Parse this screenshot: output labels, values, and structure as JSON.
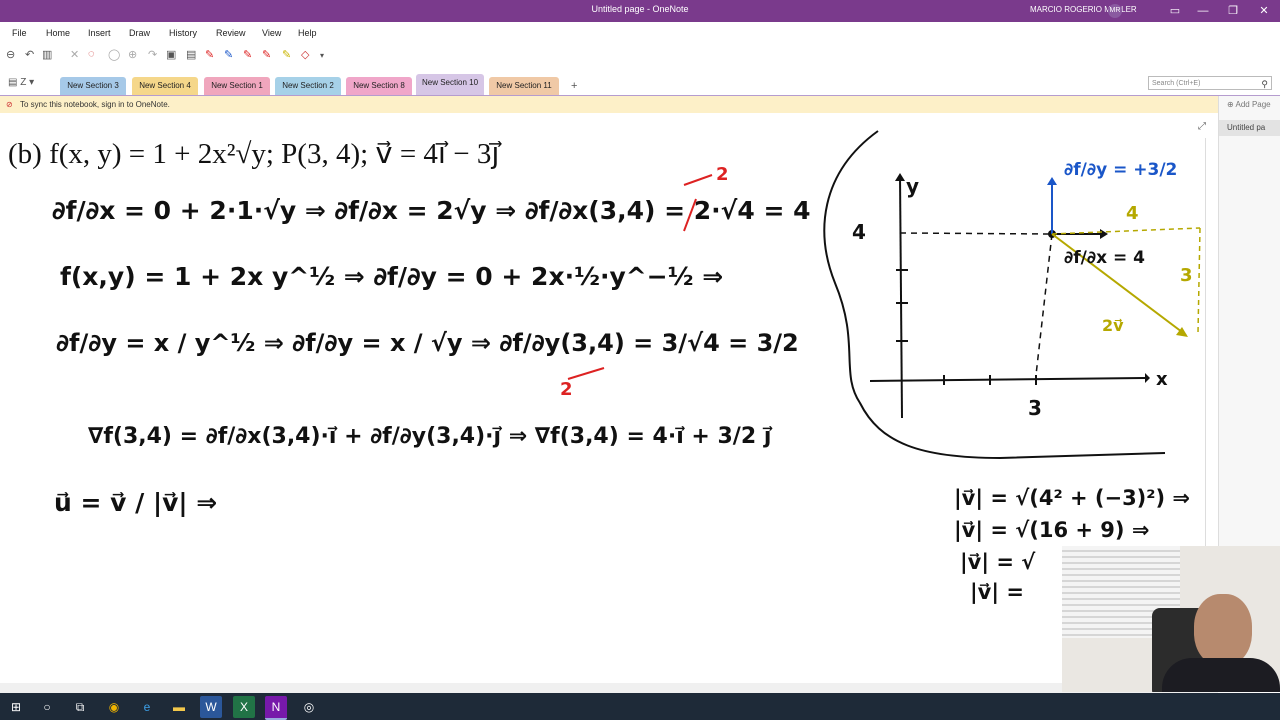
{
  "window": {
    "title": "Untitled page - OneNote",
    "user": "MARCIO ROGERIO MULLER",
    "user_initials": "MR",
    "controls": [
      "—",
      "❐",
      "✕"
    ]
  },
  "menu": [
    "File",
    "Home",
    "Insert",
    "Draw",
    "History",
    "Review",
    "View",
    "Help"
  ],
  "toolbar_icons": [
    "back-icon",
    "undo-icon",
    "layout-icon",
    "close-icon",
    "lasso-icon",
    "eraser-icon",
    "insert-space-icon",
    "print-icon",
    "clip-icon",
    "pen-red-icon",
    "pen-blue-icon",
    "pen-red2-icon",
    "pen-yellow-icon",
    "pen-highlighter-icon",
    "eraser2-icon",
    "dropdown-icon"
  ],
  "sections": [
    {
      "label": "New Section 3",
      "color": "#a6c9e8"
    },
    {
      "label": "New Section 4",
      "color": "#f5d78a"
    },
    {
      "label": "New Section 1",
      "color": "#f0a6bd"
    },
    {
      "label": "New Section 2",
      "color": "#a6d1e8"
    },
    {
      "label": "New Section 8",
      "color": "#f0a6c9"
    },
    {
      "label": "New Section 10",
      "color": "#d6c6e6",
      "active": true
    },
    {
      "label": "New Section 11",
      "color": "#f0c9a6"
    }
  ],
  "add_section": "+",
  "notebook_nav": "Z",
  "search": {
    "placeholder": "Search (Ctrl+E)"
  },
  "notice": "To sync this notebook, sign in to OneNote.",
  "pages": {
    "add_label": "Add Page",
    "items": [
      "Untitled pa"
    ]
  },
  "note": {
    "problem": "(b)   f(x, y) = 1 + 2x²√y;    P(3, 4);    v⃗ = 4i⃗ − 3j⃗",
    "line1": "∂f/∂x = 0 + 2·1·√y ⇒ ∂f/∂x = 2√y ⇒ ∂f/∂x(3,4) = 2·√4 = 4",
    "line2": "f(x,y) = 1 + 2x y^½ ⇒ ∂f/∂y = 0 + 2x·½·y^−½ ⇒",
    "line3": "∂f/∂y = x / y^½ ⇒ ∂f/∂y = x / √y ⇒ ∂f/∂y(3,4) = 3/√4 = 3/2",
    "line4": "∇f(3,4) = ∂f/∂x(3,4)·i⃗ + ∂f/∂y(3,4)·j⃗ ⇒ ∇f(3,4) = 4·i⃗ + 3/2 j⃗",
    "line5": "u⃗ = v⃗ / |v⃗| ⇒",
    "norm1": "|v⃗| = √(4² + (−3)²) ⇒",
    "norm2": "|v⃗| = √(16 + 9) ⇒",
    "norm3": "|v⃗| = √",
    "norm4": "|v⃗| =",
    "red_2_a": "2",
    "red_2_b": "2",
    "graph": {
      "x_label": "x",
      "y_label": "y",
      "tick_x": "3",
      "tick_y": "4",
      "blue_label": "∂f/∂y = +3/2",
      "black_label": "∂f/∂x = 4",
      "yellow_4": "4",
      "yellow_3": "3",
      "yellow_v": "2v⃗"
    }
  }
}
